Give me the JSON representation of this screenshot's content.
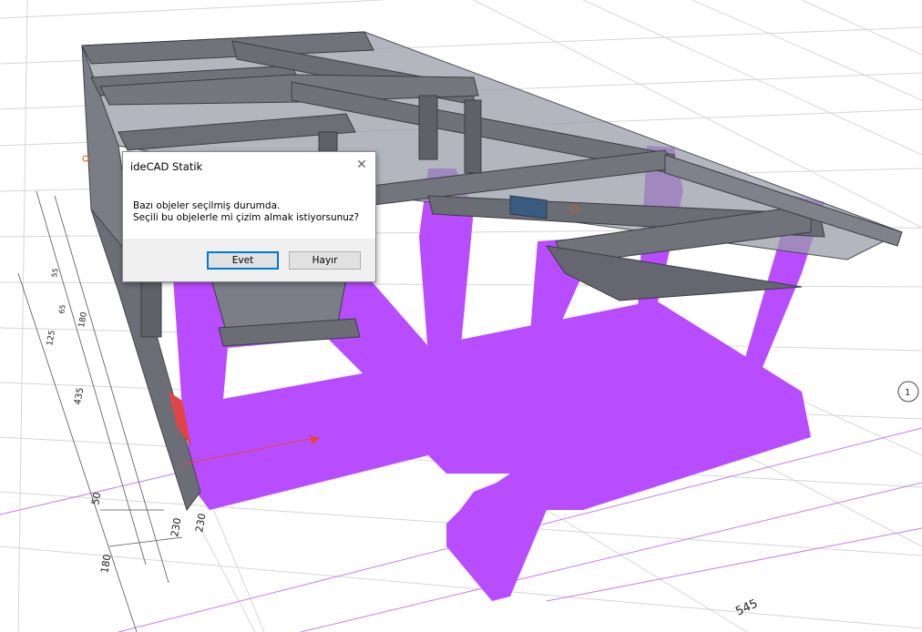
{
  "dialog": {
    "title": "ideCAD Statik",
    "message_line1": "Bazı objeler seçilmiş durumda.",
    "message_line2": "Seçili bu objelerle mi çizim almak istiyorsunuz?",
    "yes_label": "Evet",
    "no_label": "Hayır",
    "close_glyph": "✕"
  },
  "dimensions": {
    "left_labels": [
      "50",
      "230",
      "180",
      "230",
      "435",
      "125",
      "180",
      "55",
      "65"
    ],
    "bottom_labels": [
      "545"
    ],
    "axis_marker": "1"
  },
  "colors": {
    "selection": "#b84dff",
    "concrete": "#6e7078",
    "concrete_light": "#8a8d96",
    "slab": "#7b7f8a",
    "grid": "#d4d4d4",
    "axis_line": "#b04de6",
    "accent": "#0078d7"
  }
}
